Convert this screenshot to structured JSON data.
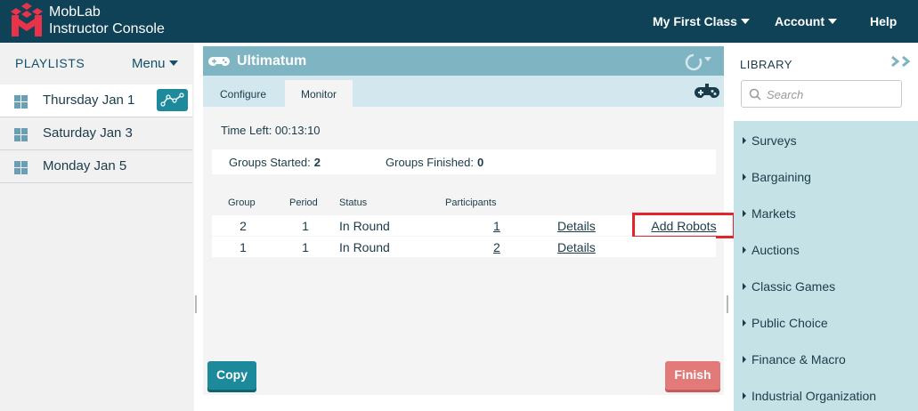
{
  "app": {
    "brand_line1": "MobLab",
    "brand_line2": "Instructor Console",
    "nav": {
      "class_menu": "My First Class",
      "account": "Account",
      "help": "Help"
    }
  },
  "playlists": {
    "title": "PLAYLISTS",
    "menu_label": "Menu",
    "items": [
      {
        "label": "Thursday Jan 1"
      },
      {
        "label": "Saturday Jan 3"
      },
      {
        "label": "Monday Jan 5"
      }
    ]
  },
  "game": {
    "title": "Ultimatum",
    "tabs": [
      {
        "label": "Configure"
      },
      {
        "label": "Monitor"
      }
    ],
    "active_tab": "Monitor",
    "time_left": "Time Left: 00:13:10",
    "groups_started_label": "Groups Started:",
    "groups_started_value": "2",
    "groups_finished_label": "Groups Finished:",
    "groups_finished_value": "0",
    "table": {
      "headers": [
        "Group",
        "Period",
        "Status",
        "Participants"
      ],
      "rows": [
        {
          "group": "2",
          "period": "1",
          "status": "In Round",
          "participants": "1",
          "details": "Details",
          "add_robots": "Add Robots"
        },
        {
          "group": "1",
          "period": "1",
          "status": "In Round",
          "participants": "2",
          "details": "Details"
        }
      ]
    },
    "copy_button": "Copy",
    "finish_button": "Finish"
  },
  "library": {
    "title": "LIBRARY",
    "search_placeholder": "Search",
    "items": [
      {
        "label": "Surveys"
      },
      {
        "label": "Bargaining"
      },
      {
        "label": "Markets"
      },
      {
        "label": "Auctions"
      },
      {
        "label": "Classic Games"
      },
      {
        "label": "Public Choice"
      },
      {
        "label": "Finance & Macro"
      },
      {
        "label": "Industrial Organization"
      }
    ]
  },
  "colors": {
    "topbar": "#0f4257",
    "accent_teal": "#1c8a9a",
    "card_header": "#7fb4c3",
    "library_bg": "#c5e3e6",
    "finish": "#e37a7a",
    "highlight_box": "#e3242b"
  }
}
